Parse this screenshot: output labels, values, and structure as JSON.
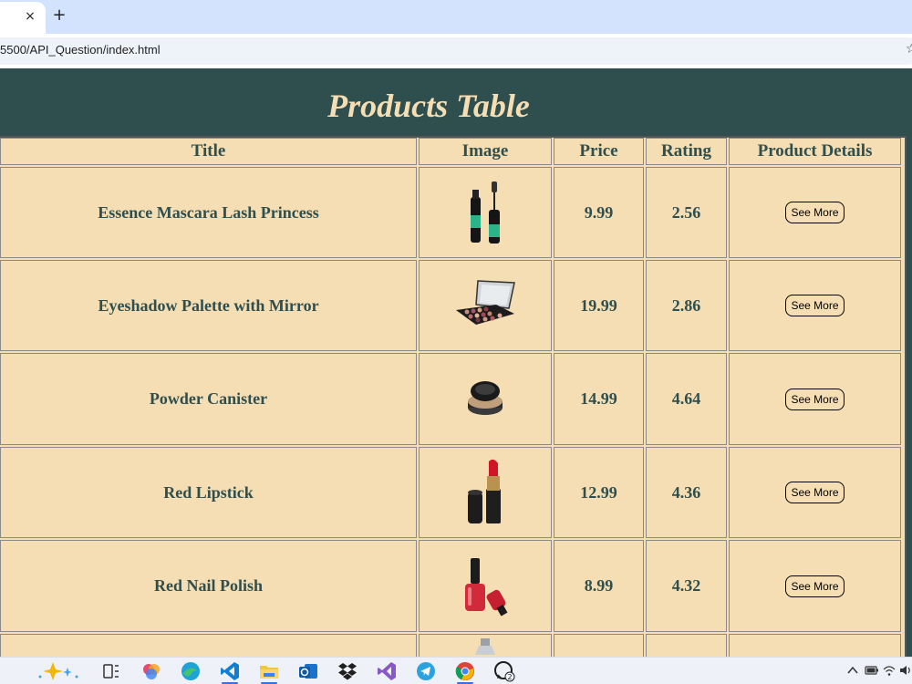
{
  "browser": {
    "close_glyph": "×",
    "new_tab_glyph": "+",
    "url": "5500/API_Question/index.html",
    "bookmark_glyph": "☆"
  },
  "page": {
    "title": "Products Table"
  },
  "table": {
    "headers": [
      "Title",
      "Image",
      "Price",
      "Rating",
      "Product Details"
    ],
    "rows": [
      {
        "title": "Essence Mascara Lash Princess",
        "image": "mascara-image",
        "price": "9.99",
        "rating": "2.56",
        "details": "See More"
      },
      {
        "title": "Eyeshadow Palette with Mirror",
        "image": "eyeshadow-palette-image",
        "price": "19.99",
        "rating": "2.86",
        "details": "See More"
      },
      {
        "title": "Powder Canister",
        "image": "powder-canister-image",
        "price": "14.99",
        "rating": "4.64",
        "details": "See More"
      },
      {
        "title": "Red Lipstick",
        "image": "lipstick-image",
        "price": "12.99",
        "rating": "4.36",
        "details": "See More"
      },
      {
        "title": "Red Nail Polish",
        "image": "nail-polish-image",
        "price": "8.99",
        "rating": "4.32",
        "details": "See More"
      }
    ]
  },
  "taskbar": {
    "whatsapp_badge": "2",
    "icons": [
      "copilot-sparkle-icon",
      "task-view-icon",
      "copilot-app-icon",
      "edge-icon",
      "vscode-icon",
      "file-explorer-icon",
      "outlook-icon",
      "dropbox-icon",
      "visual-studio-icon",
      "telegram-icon",
      "chrome-icon",
      "whatsapp-icon"
    ],
    "tray": [
      "chevron-up-icon",
      "battery-icon",
      "wifi-icon",
      "volume-icon"
    ]
  },
  "colors": {
    "background": "#2f4f4f",
    "table_fill": "#f5deb3",
    "title_text": "#f5deb3",
    "cell_text": "#2f4f4f"
  }
}
